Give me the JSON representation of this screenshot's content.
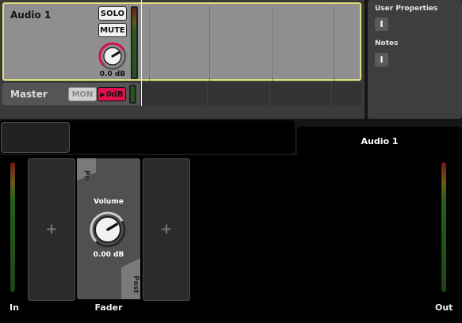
{
  "arrangement": {
    "track": {
      "name": "Audio 1",
      "solo_label": "SOLO",
      "mute_label": "MUTE",
      "volume_label": "0.0 dB",
      "volume_knob_value": 0.72
    },
    "master": {
      "name": "Master",
      "mon_label": "MON",
      "odb_label": "0dB"
    }
  },
  "properties": {
    "user_properties_label": "User Properties",
    "notes_label": "Notes",
    "edit_icon": "text-cursor-icon"
  },
  "device_chain": {
    "active_tab_label": "Audio 1",
    "in_label": "In",
    "out_label": "Out",
    "fader": {
      "label": "Fader",
      "pre_label": "Pre",
      "post_label": "Post",
      "volume_title": "Volume",
      "volume_value": "0.00 dB",
      "volume_knob_value": 0.72
    },
    "add_slot_icon": "plus-icon"
  },
  "colors": {
    "track_selected_border": "#e1e07a",
    "track_knob_ring": "#d8104a",
    "odb_button": "#e0104a",
    "meter_low": "#2e6e22",
    "meter_high": "#8a1a1a"
  }
}
